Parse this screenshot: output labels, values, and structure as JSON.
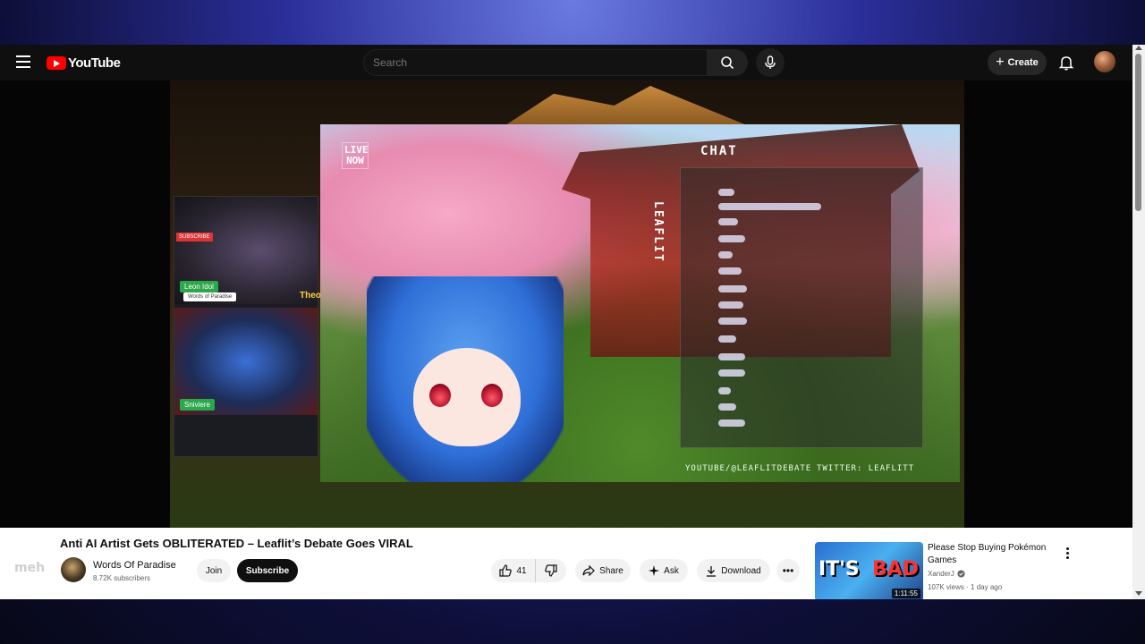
{
  "header": {
    "logo_text": "YouTube",
    "search_placeholder": "Search",
    "create_label": "Create"
  },
  "player": {
    "overlay": {
      "live_now": "LIVE NOW",
      "chat_label": "CHAT",
      "leaflit_vertical": "LEAFLIT",
      "footer_left": "YOUTUBE/@LEAFLITDEBATE",
      "footer_right": "TWITTER: LEAFLITT",
      "cam_tag_top": "Leon Idol",
      "cam_tag_top_sub": "Words of Paradise",
      "cam_tag_bottom": "Sniviere",
      "cam_subscribe": "SUBSCRIBE",
      "cam_theo": "Theo"
    }
  },
  "video": {
    "title": "Anti AI Artist Gets OBLITERATED – Leaflit’s Debate Goes VIRAL",
    "watermark": "meh",
    "channel_name": "Words Of Paradise",
    "subscribers": "8.72K subscribers",
    "join_label": "Join",
    "subscribe_label": "Subscribe",
    "like_count": "41",
    "share_label": "Share",
    "ask_label": "Ask",
    "download_label": "Download"
  },
  "recommended": {
    "title": "Please Stop Buying Pokémon Games",
    "channel": "XanderJ",
    "views": "107K views",
    "age": "1 day ago",
    "duration": "1:11:55",
    "thumb_text_1": "IT'S",
    "thumb_text_2": "BAD"
  },
  "colors": {
    "brand_red": "#ff0000",
    "subscribe_bg": "#0f0f0f"
  }
}
